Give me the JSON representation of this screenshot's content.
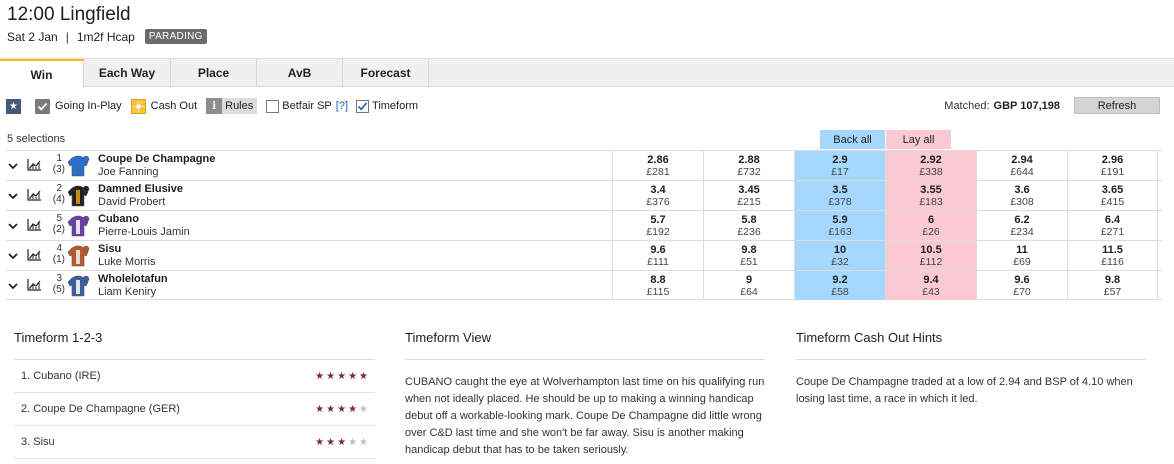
{
  "race": {
    "title": "12:00 Lingfield",
    "date": "Sat 2 Jan",
    "separator": "|",
    "info": "1m2f Hcap",
    "status": "PARADING"
  },
  "tabs": [
    {
      "label": "Win",
      "active": true
    },
    {
      "label": "Each Way"
    },
    {
      "label": "Place"
    },
    {
      "label": "AvB"
    },
    {
      "label": "Forecast"
    }
  ],
  "options": {
    "going_in_play": "Going In-Play",
    "cash_out": "Cash Out",
    "rules": "Rules",
    "betfair_sp": "Betfair SP",
    "help": "[?]",
    "timeform": "Timeform",
    "matched_label": "Matched:",
    "matched_value": "GBP 107,198",
    "refresh": "Refresh"
  },
  "selections_count": "5 selections",
  "back_all": "Back all",
  "lay_all": "Lay all",
  "colors": {
    "back": "#a6d8ff",
    "lay": "#fac9d4",
    "active_tab_accent": "#ffb80c",
    "star": "#7a2b35"
  },
  "runners": [
    {
      "number": "1",
      "draw": "(3)",
      "horse": "Coupe De Champagne",
      "jockey": "Joe Fanning",
      "silk_colors": [
        "#2a6fc9",
        "#2a6fc9"
      ],
      "prices": [
        {
          "odds": "2.86",
          "amount": "£281"
        },
        {
          "odds": "2.88",
          "amount": "£732"
        },
        {
          "odds": "2.9",
          "amount": "£17"
        },
        {
          "odds": "2.92",
          "amount": "£338"
        },
        {
          "odds": "2.94",
          "amount": "£644"
        },
        {
          "odds": "2.96",
          "amount": "£191"
        }
      ]
    },
    {
      "number": "2",
      "draw": "(4)",
      "horse": "Damned Elusive",
      "jockey": "David Probert",
      "silk_colors": [
        "#222222",
        "#e3a21a"
      ],
      "prices": [
        {
          "odds": "3.4",
          "amount": "£376"
        },
        {
          "odds": "3.45",
          "amount": "£215"
        },
        {
          "odds": "3.5",
          "amount": "£378"
        },
        {
          "odds": "3.55",
          "amount": "£183"
        },
        {
          "odds": "3.6",
          "amount": "£308"
        },
        {
          "odds": "3.65",
          "amount": "£415"
        }
      ]
    },
    {
      "number": "5",
      "draw": "(2)",
      "horse": "Cubano",
      "jockey": "Pierre-Louis Jamin",
      "silk_colors": [
        "#6a3fa8",
        "#ffffff"
      ],
      "prices": [
        {
          "odds": "5.7",
          "amount": "£192"
        },
        {
          "odds": "5.8",
          "amount": "£236"
        },
        {
          "odds": "5.9",
          "amount": "£163"
        },
        {
          "odds": "6",
          "amount": "£26"
        },
        {
          "odds": "6.2",
          "amount": "£234"
        },
        {
          "odds": "6.4",
          "amount": "£271"
        }
      ]
    },
    {
      "number": "4",
      "draw": "(1)",
      "horse": "Sisu",
      "jockey": "Luke Morris",
      "silk_colors": [
        "#b85a2a",
        "#f2f2f2"
      ],
      "prices": [
        {
          "odds": "9.6",
          "amount": "£111"
        },
        {
          "odds": "9.8",
          "amount": "£51"
        },
        {
          "odds": "10",
          "amount": "£32"
        },
        {
          "odds": "10.5",
          "amount": "£112"
        },
        {
          "odds": "11",
          "amount": "£69"
        },
        {
          "odds": "11.5",
          "amount": "£116"
        }
      ]
    },
    {
      "number": "3",
      "draw": "(5)",
      "horse": "Wholelotafun",
      "jockey": "Liam Keniry",
      "silk_colors": [
        "#3a5fa0",
        "#ffffff"
      ],
      "prices": [
        {
          "odds": "8.8",
          "amount": "£115"
        },
        {
          "odds": "9",
          "amount": "£64"
        },
        {
          "odds": "9.2",
          "amount": "£58"
        },
        {
          "odds": "9.4",
          "amount": "£43"
        },
        {
          "odds": "9.6",
          "amount": "£70"
        },
        {
          "odds": "9.8",
          "amount": "£57"
        }
      ]
    }
  ],
  "timeform_123": {
    "title": "Timeform 1-2-3",
    "items": [
      {
        "label": "1. Cubano (IRE)",
        "stars": 5
      },
      {
        "label": "2. Coupe De Champagne (GER)",
        "stars": 4
      },
      {
        "label": "3. Sisu",
        "stars": 3
      }
    ],
    "max_stars": 5
  },
  "timeform_view": {
    "title": "Timeform View",
    "text": "CUBANO caught the eye at Wolverhampton last time on his qualifying run when not ideally placed. He should be up to making a winning handicap debut off a workable-looking mark. Coupe De Champagne did little wrong over C&D last time and she won't be far away. Sisu is another making handicap debut that has to be taken seriously."
  },
  "cashout_hints": {
    "title": "Timeform Cash Out Hints",
    "text": "Coupe De Champagne traded at a low of 2.94 and BSP of 4.10 when losing last time, a race in which it led."
  }
}
